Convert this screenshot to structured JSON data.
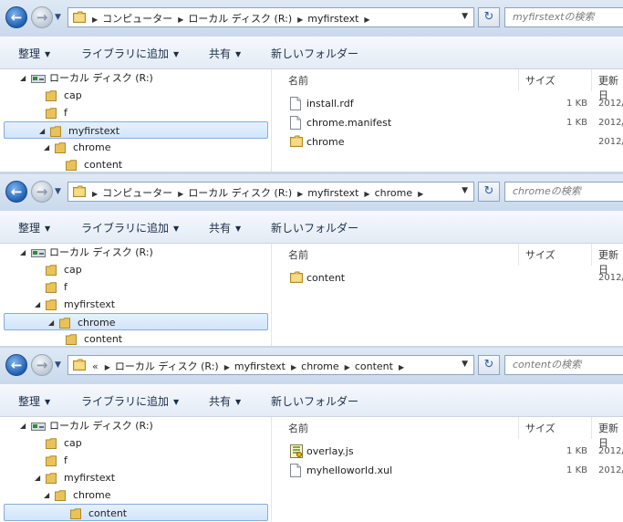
{
  "toolbar": {
    "organize": "整理",
    "library": "ライブラリに追加",
    "share": "共有",
    "new_folder": "新しいフォルダー"
  },
  "columns": {
    "name": "名前",
    "size": "サイズ",
    "date": "更新日"
  },
  "tree": {
    "drive": "ローカル ディスク (R:)",
    "cap": "cap",
    "f": "f",
    "myfirstext": "myfirstext",
    "chrome": "chrome",
    "content": "content"
  },
  "panels": [
    {
      "crumbs": [
        "コンピューター",
        "ローカル ディスク (R:)",
        "myfirstext"
      ],
      "crumb_prefix": "",
      "search_placeholder": "myfirstextの検索",
      "files": [
        {
          "name": "install.rdf",
          "size": "1 KB",
          "date": "2012/",
          "icon": "document-icon"
        },
        {
          "name": "chrome.manifest",
          "size": "1 KB",
          "date": "2012/",
          "icon": "document-icon"
        },
        {
          "name": "chrome",
          "size": "",
          "date": "2012/",
          "icon": "folder-icon"
        }
      ]
    },
    {
      "crumbs": [
        "コンピューター",
        "ローカル ディスク (R:)",
        "myfirstext",
        "chrome"
      ],
      "crumb_prefix": "",
      "search_placeholder": "chromeの検索",
      "files": [
        {
          "name": "content",
          "size": "",
          "date": "2012/",
          "icon": "folder-icon"
        }
      ]
    },
    {
      "crumbs": [
        "ローカル ディスク (R:)",
        "myfirstext",
        "chrome",
        "content"
      ],
      "crumb_prefix": "«",
      "search_placeholder": "contentの検索",
      "files": [
        {
          "name": "overlay.js",
          "size": "1 KB",
          "date": "2012/",
          "icon": "script-icon"
        },
        {
          "name": "myhelloworld.xul",
          "size": "1 KB",
          "date": "2012/",
          "icon": "document-icon"
        }
      ]
    }
  ]
}
